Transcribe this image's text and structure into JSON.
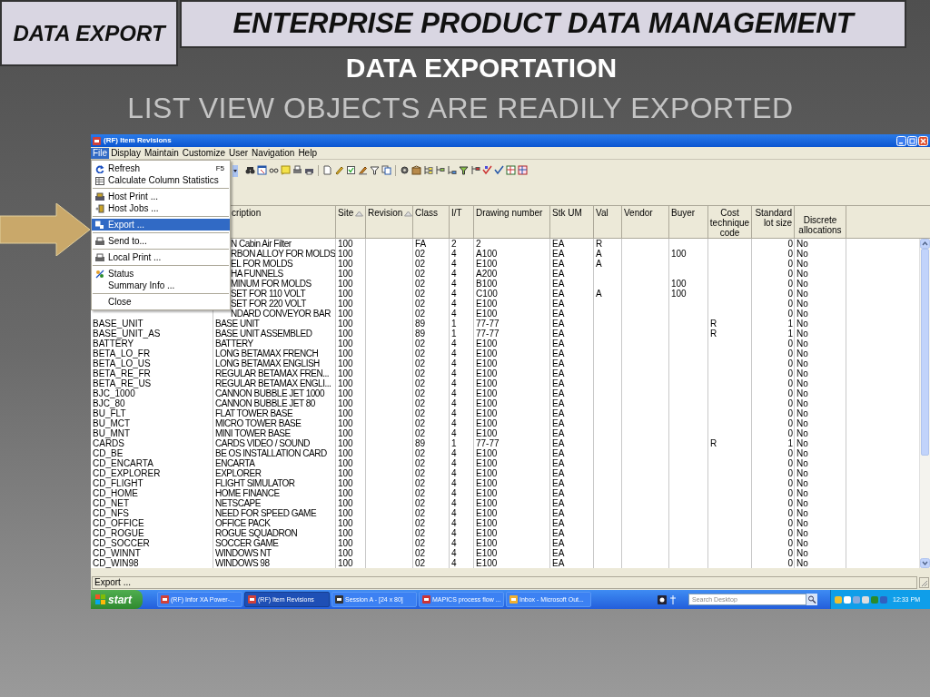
{
  "slide": {
    "section_label": "DATA EXPORT",
    "title": "ENTERPRISE PRODUCT DATA MANAGEMENT",
    "heading": "DATA EXPORTATION",
    "subheading": "LIST VIEW OBJECTS ARE READILY EXPORTED"
  },
  "window": {
    "title": "(RF) Item Revisions"
  },
  "menu_bar": [
    {
      "label": "File",
      "selected": true
    },
    {
      "label": "Display",
      "selected": false
    },
    {
      "label": "Maintain",
      "selected": false
    },
    {
      "label": "Customize",
      "selected": false
    },
    {
      "label": "User",
      "selected": false
    },
    {
      "label": "Navigation",
      "selected": false
    },
    {
      "label": "Help",
      "selected": false
    }
  ],
  "file_menu": [
    {
      "kind": "item",
      "label": "Refresh",
      "shortcut": "F5",
      "selected": false
    },
    {
      "kind": "item",
      "label": "Calculate Column Statistics",
      "selected": false
    },
    {
      "kind": "separator"
    },
    {
      "kind": "item",
      "label": "Host Print ...",
      "selected": false
    },
    {
      "kind": "item",
      "label": "Host Jobs ...",
      "selected": false
    },
    {
      "kind": "separator"
    },
    {
      "kind": "item",
      "label": "Export ...",
      "selected": true
    },
    {
      "kind": "separator"
    },
    {
      "kind": "item",
      "label": "Send to...",
      "selected": false
    },
    {
      "kind": "separator"
    },
    {
      "kind": "item",
      "label": "Local Print ...",
      "selected": false
    },
    {
      "kind": "separator"
    },
    {
      "kind": "item",
      "label": "Status",
      "selected": false
    },
    {
      "kind": "item",
      "label": "Summary Info ...",
      "selected": false
    },
    {
      "kind": "separator"
    },
    {
      "kind": "item",
      "label": "Close",
      "selected": false
    }
  ],
  "table": {
    "columns": [
      {},
      {
        "label": "cription",
        "sorted": false
      },
      {
        "label": "Site",
        "sorted": true
      },
      {
        "label": "Revision",
        "sorted": true
      },
      {
        "label": "Class",
        "sorted": false
      },
      {
        "label": "I/T",
        "sorted": false
      },
      {
        "label": "Drawing number",
        "sorted": false
      },
      {
        "label": "Stk UM",
        "sorted": false
      },
      {
        "label": "Val",
        "sorted": false
      },
      {
        "label": "Vendor",
        "sorted": false
      },
      {
        "label": "Buyer",
        "sorted": false
      },
      {
        "label": "Cost technique code",
        "sorted": false
      },
      {
        "label": "Standard lot size",
        "sorted": false
      },
      {
        "label": "Discrete allocations",
        "sorted": false
      }
    ],
    "rows": [
      {
        "description": "N Cabin Air Filter",
        "site": "100",
        "class": "FA",
        "it": "2",
        "drawing_number": "2",
        "stk_um": "EA",
        "val": "R",
        "lot_size": "0",
        "discrete": "No"
      },
      {
        "description": "RBON ALLOY FOR MOLDS",
        "site": "100",
        "class": "02",
        "it": "4",
        "drawing_number": "A100",
        "stk_um": "EA",
        "val": "A",
        "buyer": "100",
        "lot_size": "0",
        "discrete": "No"
      },
      {
        "description": "EL FOR MOLDS",
        "site": "100",
        "class": "02",
        "it": "4",
        "drawing_number": "E100",
        "stk_um": "EA",
        "val": "A",
        "lot_size": "0",
        "discrete": "No"
      },
      {
        "description": "HA FUNNELS",
        "site": "100",
        "class": "02",
        "it": "4",
        "drawing_number": "A200",
        "stk_um": "EA",
        "lot_size": "0",
        "discrete": "No"
      },
      {
        "description": "MINUM FOR MOLDS",
        "site": "100",
        "class": "02",
        "it": "4",
        "drawing_number": "B100",
        "stk_um": "EA",
        "buyer": "100",
        "lot_size": "0",
        "discrete": "No"
      },
      {
        "description": "SET FOR 110 VOLT",
        "site": "100",
        "class": "02",
        "it": "4",
        "drawing_number": "C100",
        "stk_um": "EA",
        "val": "A",
        "buyer": "100",
        "lot_size": "0",
        "discrete": "No"
      },
      {
        "description": "SET FOR 220 VOLT",
        "site": "100",
        "class": "02",
        "it": "4",
        "drawing_number": "E100",
        "stk_um": "EA",
        "lot_size": "0",
        "discrete": "No"
      },
      {
        "description": "NDARD CONVEYOR BAR",
        "site": "100",
        "class": "02",
        "it": "4",
        "drawing_number": "E100",
        "stk_um": "EA",
        "lot_size": "0",
        "discrete": "No"
      },
      {
        "item": "BASE_UNIT",
        "description": "BASE UNIT",
        "site": "100",
        "class": "89",
        "it": "1",
        "drawing_number": "77-77",
        "stk_um": "EA",
        "cost_code": "R",
        "lot_size": "1",
        "discrete": "No"
      },
      {
        "item": "BASE_UNIT_AS",
        "description": "BASE UNIT ASSEMBLED",
        "site": "100",
        "class": "89",
        "it": "1",
        "drawing_number": "77-77",
        "stk_um": "EA",
        "cost_code": "R",
        "lot_size": "1",
        "discrete": "No"
      },
      {
        "item": "BATTERY",
        "description": "BATTERY",
        "site": "100",
        "class": "02",
        "it": "4",
        "drawing_number": "E100",
        "stk_um": "EA",
        "lot_size": "0",
        "discrete": "No"
      },
      {
        "item": "BETA_LO_FR",
        "description": "LONG BETAMAX FRENCH",
        "site": "100",
        "class": "02",
        "it": "4",
        "drawing_number": "E100",
        "stk_um": "EA",
        "lot_size": "0",
        "discrete": "No"
      },
      {
        "item": "BETA_LO_US",
        "description": "LONG BETAMAX ENGLISH",
        "site": "100",
        "class": "02",
        "it": "4",
        "drawing_number": "E100",
        "stk_um": "EA",
        "lot_size": "0",
        "discrete": "No"
      },
      {
        "item": "BETA_RE_FR",
        "description": "REGULAR BETAMAX FREN...",
        "site": "100",
        "class": "02",
        "it": "4",
        "drawing_number": "E100",
        "stk_um": "EA",
        "lot_size": "0",
        "discrete": "No"
      },
      {
        "item": "BETA_RE_US",
        "description": "REGULAR BETAMAX ENGLI...",
        "site": "100",
        "class": "02",
        "it": "4",
        "drawing_number": "E100",
        "stk_um": "EA",
        "lot_size": "0",
        "discrete": "No"
      },
      {
        "item": "BJC_1000",
        "description": "CANNON BUBBLE JET 1000",
        "site": "100",
        "class": "02",
        "it": "4",
        "drawing_number": "E100",
        "stk_um": "EA",
        "lot_size": "0",
        "discrete": "No"
      },
      {
        "item": "BJC_80",
        "description": "CANNON BUBBLE JET 80",
        "site": "100",
        "class": "02",
        "it": "4",
        "drawing_number": "E100",
        "stk_um": "EA",
        "lot_size": "0",
        "discrete": "No"
      },
      {
        "item": "BU_FLT",
        "description": "FLAT TOWER BASE",
        "site": "100",
        "class": "02",
        "it": "4",
        "drawing_number": "E100",
        "stk_um": "EA",
        "lot_size": "0",
        "discrete": "No"
      },
      {
        "item": "BU_MCT",
        "description": "MICRO TOWER BASE",
        "site": "100",
        "class": "02",
        "it": "4",
        "drawing_number": "E100",
        "stk_um": "EA",
        "lot_size": "0",
        "discrete": "No"
      },
      {
        "item": "BU_MNT",
        "description": "MINI TOWER BASE",
        "site": "100",
        "class": "02",
        "it": "4",
        "drawing_number": "E100",
        "stk_um": "EA",
        "lot_size": "0",
        "discrete": "No"
      },
      {
        "item": "CARDS",
        "description": "CARDS VIDEO / SOUND",
        "site": "100",
        "class": "89",
        "it": "1",
        "drawing_number": "77-77",
        "stk_um": "EA",
        "cost_code": "R",
        "lot_size": "1",
        "discrete": "No"
      },
      {
        "item": "CD_BE",
        "description": "BE OS INSTALLATION CARD",
        "site": "100",
        "class": "02",
        "it": "4",
        "drawing_number": "E100",
        "stk_um": "EA",
        "lot_size": "0",
        "discrete": "No"
      },
      {
        "item": "CD_ENCARTA",
        "description": "ENCARTA",
        "site": "100",
        "class": "02",
        "it": "4",
        "drawing_number": "E100",
        "stk_um": "EA",
        "lot_size": "0",
        "discrete": "No"
      },
      {
        "item": "CD_EXPLORER",
        "description": "EXPLORER",
        "site": "100",
        "class": "02",
        "it": "4",
        "drawing_number": "E100",
        "stk_um": "EA",
        "lot_size": "0",
        "discrete": "No"
      },
      {
        "item": "CD_FLIGHT",
        "description": "FLIGHT SIMULATOR",
        "site": "100",
        "class": "02",
        "it": "4",
        "drawing_number": "E100",
        "stk_um": "EA",
        "lot_size": "0",
        "discrete": "No"
      },
      {
        "item": "CD_HOME",
        "description": "HOME FINANCE",
        "site": "100",
        "class": "02",
        "it": "4",
        "drawing_number": "E100",
        "stk_um": "EA",
        "lot_size": "0",
        "discrete": "No"
      },
      {
        "item": "CD_NET",
        "description": "NETSCAPE",
        "site": "100",
        "class": "02",
        "it": "4",
        "drawing_number": "E100",
        "stk_um": "EA",
        "lot_size": "0",
        "discrete": "No"
      },
      {
        "item": "CD_NFS",
        "description": "NEED FOR SPEED GAME",
        "site": "100",
        "class": "02",
        "it": "4",
        "drawing_number": "E100",
        "stk_um": "EA",
        "lot_size": "0",
        "discrete": "No"
      },
      {
        "item": "CD_OFFICE",
        "description": "OFFICE PACK",
        "site": "100",
        "class": "02",
        "it": "4",
        "drawing_number": "E100",
        "stk_um": "EA",
        "lot_size": "0",
        "discrete": "No"
      },
      {
        "item": "CD_ROGUE",
        "description": "ROGUE SQUADRON",
        "site": "100",
        "class": "02",
        "it": "4",
        "drawing_number": "E100",
        "stk_um": "EA",
        "lot_size": "0",
        "discrete": "No"
      },
      {
        "item": "CD_SOCCER",
        "description": "SOCCER GAME",
        "site": "100",
        "class": "02",
        "it": "4",
        "drawing_number": "E100",
        "stk_um": "EA",
        "lot_size": "0",
        "discrete": "No"
      },
      {
        "item": "CD_WINNT",
        "description": "WINDOWS NT",
        "site": "100",
        "class": "02",
        "it": "4",
        "drawing_number": "E100",
        "stk_um": "EA",
        "lot_size": "0",
        "discrete": "No"
      },
      {
        "item": "CD_WIN98",
        "description": "WINDOWS 98",
        "site": "100",
        "class": "02",
        "it": "4",
        "drawing_number": "E100",
        "stk_um": "EA",
        "lot_size": "0",
        "discrete": "No"
      }
    ]
  },
  "status_bar": "Export ...",
  "taskbar": {
    "start": "start",
    "buttons": [
      {
        "label": "(RF) Infor XA Power-...",
        "selected": false
      },
      {
        "label": "(RF) Item Revisions",
        "selected": true
      },
      {
        "label": "Session A - [24 x 80]",
        "selected": false
      },
      {
        "label": "MAPICS process flow ...",
        "selected": false
      },
      {
        "label": "Inbox - Microsoft Out...",
        "selected": false
      }
    ],
    "search": {
      "placeholder": "Search Desktop"
    },
    "clock": "12:33 PM"
  }
}
